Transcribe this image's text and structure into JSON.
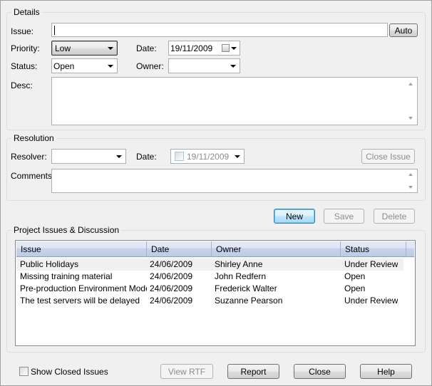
{
  "details": {
    "title": "Details",
    "issue_label": "Issue:",
    "issue_value": "",
    "auto_button": "Auto",
    "priority_label": "Priority:",
    "priority_value": "Low",
    "date_label": "Date:",
    "date_value": "19/11/2009",
    "status_label": "Status:",
    "status_value": "Open",
    "owner_label": "Owner:",
    "owner_value": "",
    "desc_label": "Desc:"
  },
  "resolution": {
    "title": "Resolution",
    "resolver_label": "Resolver:",
    "resolver_value": "",
    "date_label": "Date:",
    "date_value": "19/11/2009",
    "close_issue_button": "Close Issue",
    "comments_label": "Comments:"
  },
  "actions": {
    "new": "New",
    "save": "Save",
    "delete": "Delete"
  },
  "discussion": {
    "title": "Project Issues & Discussion",
    "columns": [
      "Issue",
      "Date",
      "Owner",
      "Status"
    ],
    "rows": [
      {
        "issue": "Public Holidays",
        "date": "24/06/2009",
        "owner": "Shirley Anne",
        "status": "Under Review"
      },
      {
        "issue": "Missing training material",
        "date": "24/06/2009",
        "owner": "John Redfern",
        "status": "Open"
      },
      {
        "issue": "Pre-production Environment Model...",
        "date": "24/06/2009",
        "owner": "Frederick Walter",
        "status": "Open"
      },
      {
        "issue": "The test servers will be delayed",
        "date": "24/06/2009",
        "owner": "Suzanne Pearson",
        "status": "Under Review"
      }
    ]
  },
  "footer": {
    "show_closed": "Show Closed Issues",
    "view_rtf": "View RTF",
    "report": "Report",
    "close": "Close",
    "help": "Help"
  }
}
